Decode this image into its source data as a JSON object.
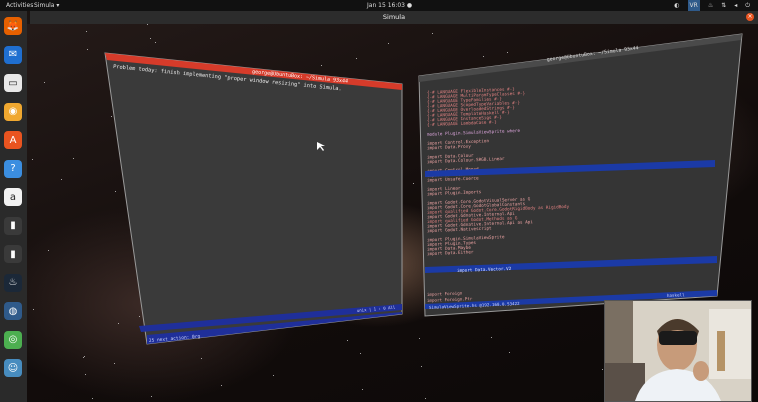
{
  "topbar": {
    "activities": "Activities",
    "app_name": "Simula ▾",
    "clock": "Jan 15  16:03 ●",
    "tray_badge": "VR"
  },
  "window": {
    "title": "Simula",
    "close_glyph": "×"
  },
  "dock": [
    {
      "name": "firefox-icon",
      "color": "#e66000",
      "glyph": "🦊"
    },
    {
      "name": "thunderbird-icon",
      "color": "#1f6fd0",
      "glyph": "✉"
    },
    {
      "name": "files-icon",
      "color": "#e8e8e8",
      "glyph": "▭"
    },
    {
      "name": "rhythmbox-icon",
      "color": "#f0a830",
      "glyph": "◉"
    },
    {
      "name": "software-icon",
      "color": "#e95420",
      "glyph": "A"
    },
    {
      "name": "help-icon",
      "color": "#3b8ee0",
      "glyph": "?"
    },
    {
      "name": "amazon-icon",
      "color": "#f2f2f2",
      "glyph": "a"
    },
    {
      "name": "terminal-icon",
      "color": "#3a3a3a",
      "glyph": "▮"
    },
    {
      "name": "terminal-icon",
      "color": "#3a3a3a",
      "glyph": "▮"
    },
    {
      "name": "steam-icon",
      "color": "#1b2838",
      "glyph": "♨"
    },
    {
      "name": "vpn-icon",
      "color": "#2f5a8a",
      "glyph": "◍"
    },
    {
      "name": "chrome-icon",
      "color": "#4caf50",
      "glyph": "◎"
    },
    {
      "name": "godot-icon",
      "color": "#478cbf",
      "glyph": "☺"
    }
  ],
  "left_terminal": {
    "title": "george@UbuntuBox: ~/Simula 93x44",
    "line1": "Problem today: finish implementing \"proper window resizing\" into Simula.",
    "statusbar_right": "unix | 1 : 0  All",
    "bottom_left": "25  next_action: 0rg",
    "accent": "#d63b2a"
  },
  "right_terminal": {
    "title": "george@UbuntuBox: ~/Simula 93x44",
    "pragmas": [
      "{-# LANGUAGE FlexibleInstances #-}",
      "{-# LANGUAGE MultiParamTypeClasses #-}",
      "{-# LANGUAGE TypeFamilies #-}",
      "{-# LANGUAGE ScopedTypeVariables #-}",
      "{-# LANGUAGE OverloadedStrings #-}",
      "{-# LANGUAGE TemplateHaskell #-}",
      "{-# LANGUAGE InstanceSigs #-}",
      "{-# LANGUAGE LambdaCase #-}"
    ],
    "module_line": "module Plugin.SimulaViewSprite where",
    "imports": [
      "import Control.Exception",
      "import Data.Proxy",
      "",
      "import Data.Colour",
      "import Data.Colour.SRGB.Linear",
      "",
      "import Control.Monad",
      "import Data.Coerce",
      "import Unsafe.Coerce",
      "",
      "import           Linear",
      "import           Plugin.Imports",
      "",
      "import           Godot.Core.GodotVisualServer as G",
      "import           Godot.Core.GodotGlobalConstants",
      "import qualified Godot.Core.GodotRigidBody as RigidBody",
      "import           Godot.Gdnative.Internal.Api",
      "import qualified Godot.Methods as G",
      "import           Godot.Gdnative.Internal.Api as Api",
      "import           Godot.Nativescript",
      "",
      "import Plugin.SimulaViewSprite",
      "import Plugin.Types",
      "import Data.Maybe",
      "import Data.Either"
    ],
    "highlight_line": "import           Data.Vector.V2",
    "footer_lines": [
      "import           Foreign",
      "import           Foreign.Ptr",
      "SimulaViewSprite.hs @192.168.0.53422"
    ],
    "status_right": "haskell",
    "accent": "#1b3aa6"
  }
}
